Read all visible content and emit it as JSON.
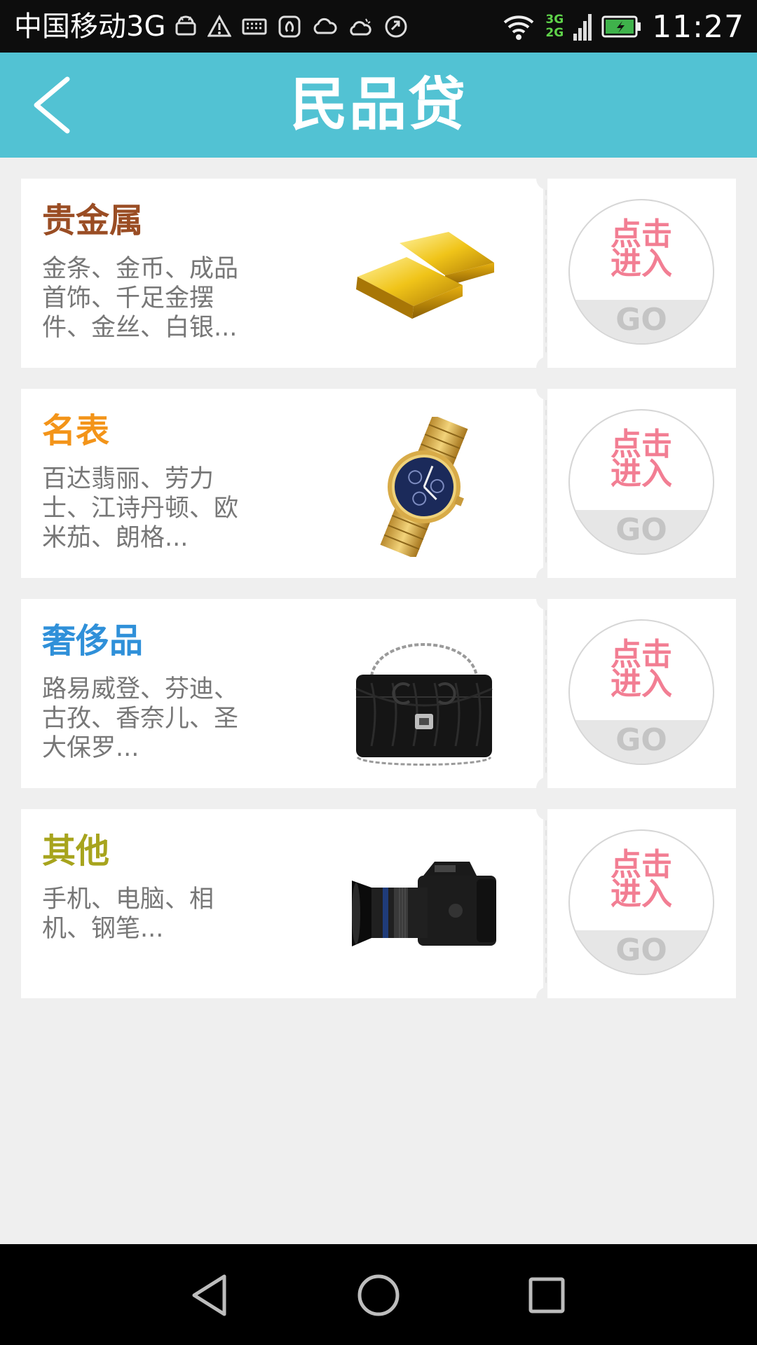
{
  "status_bar": {
    "carrier": "中国移动3G",
    "network_top": "3G",
    "network_bottom": "2G",
    "time": "11:27",
    "icons": [
      "android-icon",
      "warning-icon",
      "keyboard-icon",
      "huawei-icon",
      "cloud-icon",
      "weather-icon",
      "sync-icon",
      "wifi-icon",
      "signal-icon",
      "battery-charging-icon"
    ]
  },
  "header": {
    "title": "民品贷",
    "back_icon": "chevron-left-icon",
    "background": "#52c2d3"
  },
  "categories": [
    {
      "title": "贵金属",
      "title_color": "#9a4d24",
      "desc": "金条、金币、成品首饰、千足金摆件、金丝、白银...",
      "image": "gold-bar-image",
      "go_text": "点击进入",
      "go_label": "GO"
    },
    {
      "title": "名表",
      "title_color": "#f39419",
      "desc": "百达翡丽、劳力士、江诗丹顿、欧米茄、朗格...",
      "image": "watch-image",
      "go_text": "点击进入",
      "go_label": "GO"
    },
    {
      "title": "奢侈品",
      "title_color": "#2f90d9",
      "desc": "路易威登、芬迪、古孜、香奈儿、圣大保罗...",
      "image": "handbag-image",
      "go_text": "点击进入",
      "go_label": "GO"
    },
    {
      "title": "其他",
      "title_color": "#a7a41d",
      "desc": "手机、电脑、相机、钢笔...",
      "image": "camera-image",
      "go_text": "点击进入",
      "go_label": "GO"
    }
  ],
  "nav_bar": {
    "buttons": [
      "back-triangle-icon",
      "home-circle-icon",
      "recents-square-icon"
    ]
  }
}
